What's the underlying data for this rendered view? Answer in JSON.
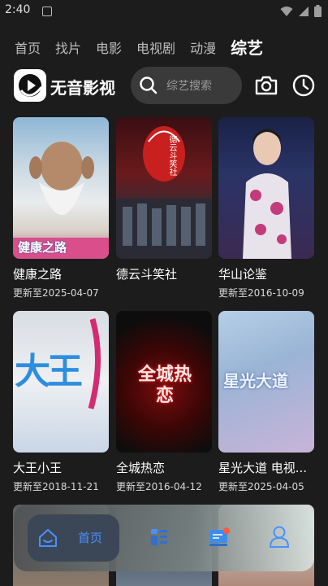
{
  "status_bar": {
    "time": "2:40"
  },
  "tabs": [
    {
      "label": "首页"
    },
    {
      "label": "找片"
    },
    {
      "label": "电影"
    },
    {
      "label": "电视剧"
    },
    {
      "label": "动漫"
    },
    {
      "label": "综艺",
      "active": true
    }
  ],
  "header": {
    "app_name": "无音影视",
    "search_placeholder": "综艺搜索",
    "icons": [
      "logo-icon",
      "search-icon",
      "camera-icon",
      "history-icon"
    ]
  },
  "shows": [
    {
      "title": "健康之路",
      "update": "更新至2025-04-07",
      "poster_text": "健康之路"
    },
    {
      "title": "德云斗笑社",
      "update": "",
      "poster_text": "德云斗笑社"
    },
    {
      "title": "华山论鉴",
      "update": "更新至2016-10-09",
      "poster_text": ""
    },
    {
      "title": "大王小王",
      "update": "更新至2018-11-21",
      "poster_text": "大王"
    },
    {
      "title": "全城热恋",
      "update": "更新至2016-04-12",
      "poster_text": "全城热恋"
    },
    {
      "title": "星光大道 电视...",
      "update": "更新至2025-04-05",
      "poster_text": "星光大道"
    }
  ],
  "bottom_nav": {
    "items": [
      {
        "label": "首页",
        "icon": "home-icon",
        "active": true
      },
      {
        "label": "",
        "icon": "category-icon"
      },
      {
        "label": "",
        "icon": "message-icon"
      },
      {
        "label": "",
        "icon": "user-icon"
      }
    ]
  },
  "colors": {
    "accent": "#4a90ff",
    "background": "#1c1c1c"
  }
}
